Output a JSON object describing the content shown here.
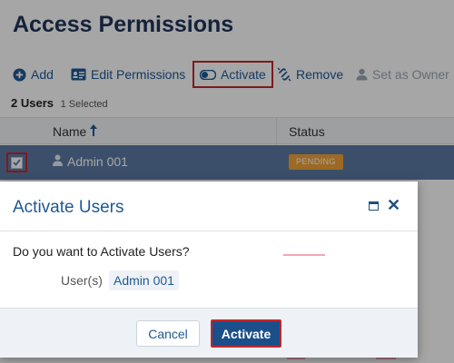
{
  "page": {
    "title": "Access Permissions"
  },
  "toolbar": {
    "add_label": "Add",
    "edit_label": "Edit Permissions",
    "activate_label": "Activate",
    "remove_label": "Remove",
    "owner_label": "Set as Owner"
  },
  "summary": {
    "users_count": "2 Users",
    "selected_count": "1",
    "selected_label": "Selected"
  },
  "grid": {
    "columns": [
      "Name",
      "Status"
    ],
    "rows": [
      {
        "name": "Admin 001",
        "status": "PENDING",
        "selected": true
      }
    ]
  },
  "dialog": {
    "title": "Activate Users",
    "question": "Do you want to Activate Users?",
    "users_label": "User(s)",
    "users_value": "Admin 001",
    "cancel_label": "Cancel",
    "confirm_label": "Activate"
  },
  "icons": {
    "add": "plus-circle-icon",
    "edit": "id-card-icon",
    "activate": "toggle-icon",
    "remove": "unlink-icon",
    "owner": "user-icon",
    "sort": "arrow-up-icon",
    "user": "person-icon",
    "maximize": "maximize-icon",
    "close": "close-icon"
  },
  "colors": {
    "title": "#1f3559",
    "link": "#1e5a96",
    "selected_row": "#5b7aa4",
    "pending_badge": "#f0a33a",
    "primary_button": "#1b4f8a",
    "highlight_border": "#c0282d"
  }
}
